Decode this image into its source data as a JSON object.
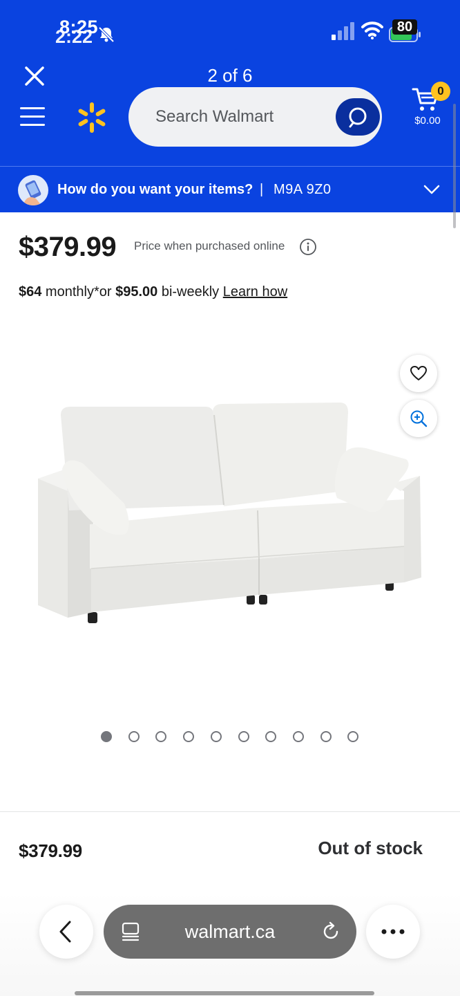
{
  "status_bar": {
    "time_primary": "8:25",
    "time_overlay": "2:22",
    "battery": "80"
  },
  "header": {
    "page_counter": "2 of 6",
    "search_placeholder": "Search Walmart",
    "cart_count": "0",
    "cart_total": "$0.00",
    "brand_color": "#0a43e0",
    "accent_color": "#ffc220"
  },
  "delivery": {
    "question": "How do you want your items?",
    "separator": "|",
    "postal_code": "M9A 9Z0"
  },
  "product": {
    "price": "$379.99",
    "price_note": "Price when purchased online",
    "installment_monthly": "$64",
    "installment_monthly_text": " monthly*or ",
    "installment_biweekly": "$95.00",
    "installment_biweekly_text": " bi-weekly ",
    "learn_how": "Learn how",
    "image_count": 10,
    "active_image": 1
  },
  "sticky_footer": {
    "price": "$379.99",
    "stock_status": "Out of stock"
  },
  "browser": {
    "url": "walmart.ca"
  }
}
